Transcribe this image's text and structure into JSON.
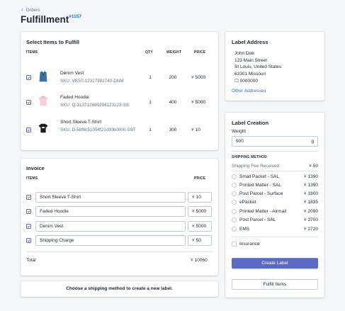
{
  "breadcrumb": {
    "back_label": "Orders"
  },
  "page": {
    "title_prefix": "Fulfillment",
    "order_number": "#1157"
  },
  "items_card": {
    "title": "Select Items to Fulfill",
    "columns": {
      "items": "ITEMS",
      "qty": "QTY",
      "weight": "WEIGHT",
      "price": "PRICE"
    },
    "items": [
      {
        "name": "Denim Vest",
        "sku": "SKU: VEST-12317982740-DNM",
        "qty": "1",
        "weight": "200",
        "currency": "¥",
        "price": "5000",
        "checked": true,
        "thumb_color": "#3f6fa3"
      },
      {
        "name": "Faded Hoodie",
        "sku": "SKU: Q-21371288029412312​3-SS",
        "qty": "1",
        "weight": "400",
        "currency": "¥",
        "price": "5000",
        "checked": true,
        "thumb_color": "#f0c8d4"
      },
      {
        "name": "Short Sleeve T-Shirt",
        "sku": "SKU: D-58f6c51054f21c00b0000-SST",
        "qty": "1",
        "weight": "300",
        "currency": "¥",
        "price": "10",
        "checked": true,
        "thumb_color": "#1c1c1c"
      }
    ]
  },
  "invoice_card": {
    "title": "Invoice",
    "columns": {
      "items": "ITEMS",
      "price": "PRICE"
    },
    "lines": [
      {
        "name": "Short Sleeve T-Shirt",
        "currency": "¥",
        "price": "10"
      },
      {
        "name": "Faded Hoodie",
        "currency": "¥",
        "price": "5000"
      },
      {
        "name": "Denim Vest",
        "currency": "¥",
        "price": "5000"
      },
      {
        "name": "Shipping Charge",
        "currency": "¥",
        "price": "50"
      }
    ],
    "total_label": "Total",
    "total_currency": "¥",
    "total_value": "10060"
  },
  "footer_note": "Choose a shipping method to create a new label.",
  "label_address": {
    "title": "Label Address",
    "lines": [
      "John Doe",
      "123 Main Street",
      "St Louis, United States",
      "63301 Missouri",
      "☐ 0000000"
    ],
    "other_link": "Other Addresses"
  },
  "label_creation": {
    "title": "Label Creation",
    "weight_label": "Weight",
    "weight_value": "900",
    "weight_unit": "g",
    "shipping_method_heading": "SHIPPING METHOD",
    "fee_label": "Shipping Fee Received",
    "fee_currency": "¥",
    "fee_value": "50",
    "methods": [
      {
        "name": "Small Packet - SAL",
        "currency": "¥",
        "price": "1390"
      },
      {
        "name": "Printed Matter - SAL",
        "currency": "¥",
        "price": "1390"
      },
      {
        "name": "Post Parcel - Surface",
        "currency": "¥",
        "price": "1800"
      },
      {
        "name": "ePacket",
        "currency": "¥",
        "price": "1835"
      },
      {
        "name": "Printed Matter - Airmail",
        "currency": "¥",
        "price": "2090"
      },
      {
        "name": "Post Parcel - SAL",
        "currency": "¥",
        "price": "2700"
      },
      {
        "name": "EMS",
        "currency": "¥",
        "price": "2720"
      }
    ],
    "insurance_label": "Insurance",
    "create_button": "Create Label",
    "fulfill_button": "Fulfill Items"
  },
  "colors": {
    "accent": "#5c6ac4",
    "link": "#2b6fc6",
    "background": "#f4f6f8"
  }
}
